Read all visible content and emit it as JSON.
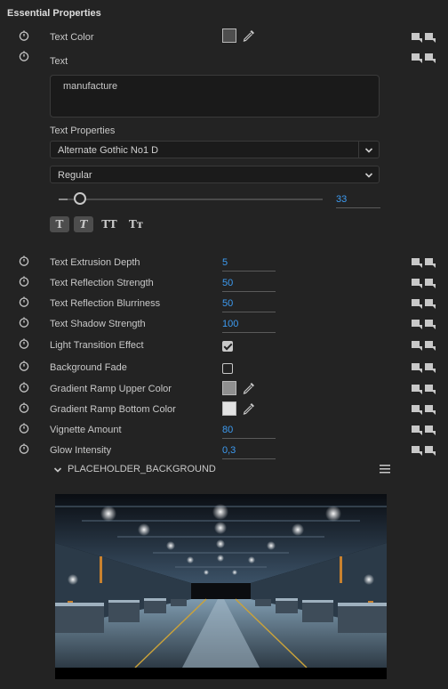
{
  "panel": {
    "title": "Essential Properties"
  },
  "text_color": {
    "label": "Text Color",
    "swatch_color": "#4e4e4e"
  },
  "text_section": {
    "label": "Text",
    "value": "manufacture"
  },
  "text_properties": {
    "label": "Text Properties",
    "font_family": "Alternate Gothic No1 D",
    "font_style": "Regular",
    "font_size": "33",
    "font_size_level": 0.08,
    "style_buttons": [
      {
        "label": "T",
        "name": "bold-style-button",
        "active": true
      },
      {
        "label": "T",
        "name": "italic-style-button",
        "active": true
      },
      {
        "label": "TT",
        "name": "all-caps-button",
        "active": false
      },
      {
        "label": "Tт",
        "name": "small-caps-button",
        "active": false
      }
    ]
  },
  "properties": [
    {
      "label": "Text Extrusion Depth",
      "type": "number",
      "value": "5"
    },
    {
      "label": "Text Reflection Strength",
      "type": "number",
      "value": "50"
    },
    {
      "label": "Text Reflection Blurriness",
      "type": "number",
      "value": "50"
    },
    {
      "label": "Text Shadow Strength",
      "type": "number",
      "value": "100"
    },
    {
      "label": "Light Transition Effect",
      "type": "checkbox",
      "checked": true
    },
    {
      "label": "Background Fade",
      "type": "checkbox",
      "checked": false
    },
    {
      "label": "Gradient Ramp Upper Color",
      "type": "color",
      "color": "#8f8f8f"
    },
    {
      "label": "Gradient Ramp Bottom Color",
      "type": "color",
      "color": "#e2e2e2"
    },
    {
      "label": "Vignette Amount",
      "type": "number",
      "value": "80"
    },
    {
      "label": "Glow Intensity",
      "type": "number",
      "value": "0,3"
    }
  ],
  "background_group": {
    "label": "PLACEHOLDER_BACKGROUND"
  },
  "colors": {
    "accent_value": "#3d9bf1",
    "panel_bg": "#232323"
  },
  "icons": {
    "stopwatch": "stopwatch-icon",
    "keyframe_nav": "keyframe-nav-icon",
    "eyedropper": "eyedropper-icon",
    "chevron": "chevron-down-icon",
    "menu": "hamburger-menu-icon"
  }
}
